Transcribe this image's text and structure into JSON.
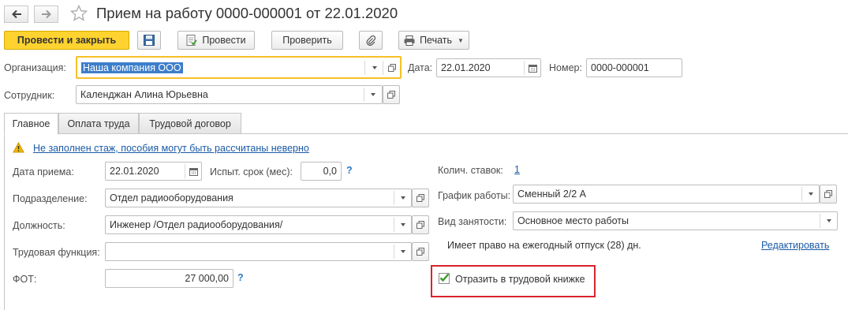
{
  "window": {
    "title": "Прием на работу 0000-000001 от 22.01.2020",
    "icons": {
      "back": "arrow-left-icon",
      "forward": "arrow-right-icon",
      "favorite": "star-icon"
    }
  },
  "toolbar": {
    "post_close_label": "Провести и закрыть",
    "post_label": "Провести",
    "check_label": "Проверить",
    "print_label": "Печать"
  },
  "header": {
    "organization_label": "Организация:",
    "organization_value": "Наша компания ООО",
    "date_label": "Дата:",
    "date_value": "22.01.2020",
    "number_label": "Номер:",
    "number_value": "0000-000001",
    "employee_label": "Сотрудник:",
    "employee_value": "Календжан Алина Юрьевна"
  },
  "tabs": [
    {
      "label": "Главное",
      "active": true
    },
    {
      "label": "Оплата труда",
      "active": false
    },
    {
      "label": "Трудовой договор",
      "active": false
    }
  ],
  "warning": {
    "text": "Не заполнен стаж, пособия могут быть рассчитаны неверно",
    "icon": "warning-icon"
  },
  "main": {
    "hire_date_label": "Дата приема:",
    "hire_date_value": "22.01.2020",
    "probation_label": "Испыт. срок (мес):",
    "probation_value": "0,0",
    "help_mark": "?",
    "department_label": "Подразделение:",
    "department_value": "Отдел радиооборудования",
    "position_label": "Должность:",
    "position_value": "Инженер /Отдел радиооборудования/",
    "labor_function_label": "Трудовая функция:",
    "labor_function_value": "",
    "fot_label": "ФОТ:",
    "fot_value": "27 000,00"
  },
  "right": {
    "rates_label": "Колич. ставок:",
    "rates_value": "1",
    "schedule_label": "График работы:",
    "schedule_value": "Сменный 2/2 А",
    "employment_label": "Вид занятости:",
    "employment_value": "Основное место работы",
    "vacation_text": "Имеет право на ежегодный отпуск (28) дн.",
    "edit_link": "Редактировать",
    "workbook_label": "Отразить в трудовой книжке",
    "workbook_checked": true
  },
  "colors": {
    "primary_button": "#ffd32f",
    "focus_border": "#f6c027",
    "highlight": "#d9232d",
    "link": "#1a5aa6",
    "checkmark": "#3a9b2b"
  }
}
